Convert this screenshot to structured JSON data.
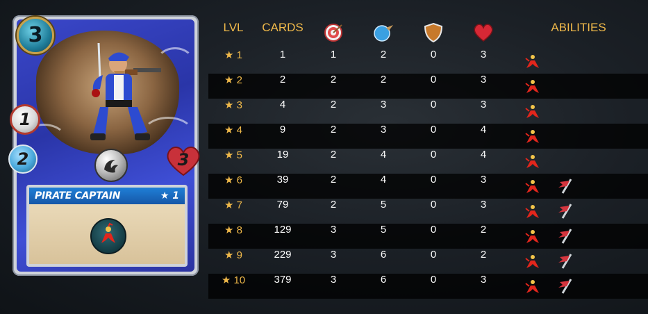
{
  "card": {
    "mana": "3",
    "attack": "1",
    "speed": "2",
    "health": "3",
    "name": "PIRATE CAPTAIN",
    "level_label": "★ 1",
    "element_icon": "water-element-icon",
    "ability_icon": "rally-ability-icon"
  },
  "table": {
    "headers": {
      "lvl": "LVL",
      "cards": "CARDS",
      "attack_icon": "target-ranged-icon",
      "speed_icon": "speed-orb-icon",
      "armor_icon": "shield-icon",
      "health_icon": "heart-icon",
      "abilities": "ABILITIES"
    },
    "rows": [
      {
        "lvl": "★ 1",
        "cards": "1",
        "attack": "1",
        "speed": "2",
        "armor": "0",
        "health": "3",
        "abilities": [
          "rally-icon"
        ]
      },
      {
        "lvl": "★ 2",
        "cards": "2",
        "attack": "2",
        "speed": "2",
        "armor": "0",
        "health": "3",
        "abilities": [
          "rally-icon"
        ]
      },
      {
        "lvl": "★ 3",
        "cards": "4",
        "attack": "2",
        "speed": "3",
        "armor": "0",
        "health": "3",
        "abilities": [
          "rally-icon"
        ]
      },
      {
        "lvl": "★ 4",
        "cards": "9",
        "attack": "2",
        "speed": "3",
        "armor": "0",
        "health": "4",
        "abilities": [
          "rally-icon"
        ]
      },
      {
        "lvl": "★ 5",
        "cards": "19",
        "attack": "2",
        "speed": "4",
        "armor": "0",
        "health": "4",
        "abilities": [
          "rally-icon"
        ]
      },
      {
        "lvl": "★ 6",
        "cards": "39",
        "attack": "2",
        "speed": "4",
        "armor": "0",
        "health": "3",
        "abilities": [
          "rally-icon",
          "flag-icon"
        ]
      },
      {
        "lvl": "★ 7",
        "cards": "79",
        "attack": "2",
        "speed": "5",
        "armor": "0",
        "health": "3",
        "abilities": [
          "rally-icon",
          "flag-icon"
        ]
      },
      {
        "lvl": "★ 8",
        "cards": "129",
        "attack": "3",
        "speed": "5",
        "armor": "0",
        "health": "2",
        "abilities": [
          "rally-icon",
          "flag-icon"
        ]
      },
      {
        "lvl": "★ 9",
        "cards": "229",
        "attack": "3",
        "speed": "6",
        "armor": "0",
        "health": "2",
        "abilities": [
          "rally-icon",
          "flag-icon"
        ]
      },
      {
        "lvl": "★ 10",
        "cards": "379",
        "attack": "3",
        "speed": "6",
        "armor": "0",
        "health": "3",
        "abilities": [
          "rally-icon",
          "flag-icon"
        ]
      }
    ]
  }
}
